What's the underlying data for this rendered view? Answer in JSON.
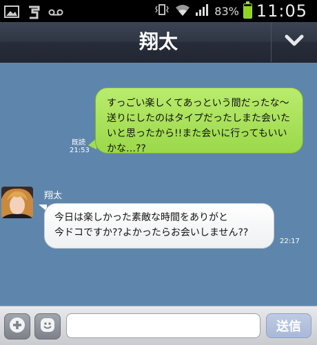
{
  "status_bar": {
    "battery_percent": "83%",
    "time": "11:05",
    "battery_level": 0.83,
    "icons": [
      "gallery-icon",
      "usb-icon",
      "voicemail-icon",
      "vibrate-icon",
      "wifi-icon",
      "signal-icon",
      "battery-icon"
    ]
  },
  "header": {
    "title": "翔太",
    "menu_icon": "chevron-down-icon"
  },
  "messages": {
    "outgoing": {
      "lines": [
        "すっごい楽しくてあっという間だったな〜",
        "送りにしたのはタイプだったしまた会いた",
        "いと思ったから!!また会いに行ってもいい",
        "かな…??"
      ],
      "read_label": "既読",
      "time": "21:53"
    },
    "incoming": {
      "sender": "翔太",
      "lines": [
        "今日は楽しかった素敵な時間をありがと",
        "今ドコですか??よかったらお会いしません??"
      ],
      "time": "22:17"
    }
  },
  "input_bar": {
    "input_value": "",
    "send_label": "送信",
    "icons": [
      "plus-icon",
      "emoticon-icon"
    ]
  },
  "colors": {
    "chat_background": "#5e86ad",
    "outgoing_bubble": "#a8e05a",
    "incoming_bubble": "#ffffff",
    "header": "#2f3644"
  }
}
